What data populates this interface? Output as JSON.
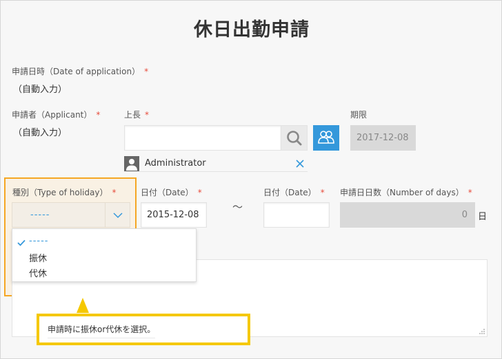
{
  "page": {
    "title": "休日出勤申請"
  },
  "application_date": {
    "label": "申請日時（Date of application）",
    "required": "*",
    "value": "（自動入力）"
  },
  "applicant": {
    "label": "申請者（Applicant）",
    "required": "*",
    "value": "（自動入力）"
  },
  "supervisor": {
    "label": "上長",
    "required": "*",
    "search_value": "",
    "selected_user": "Administrator",
    "icons": {
      "search": "search-icon",
      "org": "users-icon",
      "avatar": "user-avatar-icon",
      "remove": "close-icon"
    }
  },
  "deadline": {
    "label": "期限",
    "value": "2017-12-08"
  },
  "holiday_type": {
    "label": "種別（Type of holiday）",
    "required": "*",
    "selected": "-----",
    "options": [
      "-----",
      "振休",
      "代休"
    ]
  },
  "date_from": {
    "label": "日付（Date）",
    "required": "*",
    "value": "2015-12-08"
  },
  "range_separator": "～",
  "date_to": {
    "label": "日付（Date）",
    "required": "*",
    "value": ""
  },
  "number_of_days": {
    "label": "申請日日数（Number of days）",
    "required": "*",
    "value": "0",
    "unit": "日"
  },
  "callout": {
    "text": "申請時に振休or代休を選択。"
  },
  "colors": {
    "accent": "#3498db",
    "required": "#e74c3c",
    "highlight_border": "#f5a623",
    "callout_border": "#f5c800"
  }
}
